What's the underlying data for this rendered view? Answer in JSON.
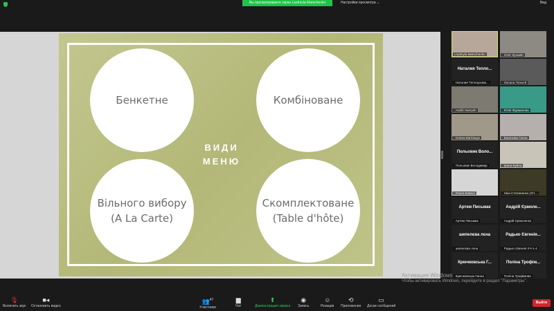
{
  "topbar": {
    "sharing_banner": "Вы просматриваете экран Liudmyla Mamchenko",
    "view_options": "Настройки просмотра ⌄",
    "view_button": "Вид"
  },
  "slide": {
    "title_line1": "ВИДИ",
    "title_line2": "МЕНЮ",
    "circles": [
      {
        "line1": "Бенкетне",
        "line2": ""
      },
      {
        "line1": "Комбіноване",
        "line2": ""
      },
      {
        "line1": "Вільного вибору",
        "line2": "(A La Carte)"
      },
      {
        "line1": "Скомплектоване",
        "line2": "(Table d'hôte)"
      }
    ]
  },
  "participants": [
    {
      "name": "Liudmyla Mamchenko",
      "big": "",
      "video": "#b7a79a",
      "active": true,
      "muted": false
    },
    {
      "name": "Олег Кузьмін",
      "big": "",
      "video": "#8d8a84",
      "muted": true
    },
    {
      "name": "Наталия Теплоухова...",
      "big": "Наталия Тепло...",
      "video": "",
      "muted": true
    },
    {
      "name": "Оксана Похоєй",
      "big": "",
      "video": "#5a5a5a",
      "muted": true
    },
    {
      "name": "Andrii Havrysh",
      "big": "",
      "video": "#7d7a72",
      "muted": true
    },
    {
      "name": "Юлія Фурманова",
      "big": "",
      "video": "#3a9a88",
      "muted": true
    },
    {
      "name": "Олена Матіяшук",
      "big": "",
      "video": "#a09888",
      "muted": true
    },
    {
      "name": "Березова Ганна",
      "big": "",
      "video": "#b5b0ad",
      "muted": true
    },
    {
      "name": "Польовик Володимир",
      "big": "Польовик Воло...",
      "video": "",
      "muted": true
    },
    {
      "name": "Ірина Буйна",
      "big": "",
      "video": "#c8c4b8",
      "muted": true
    },
    {
      "name": "Ольга Ковалі",
      "big": "",
      "video": "#d6d6d6",
      "muted": true
    },
    {
      "name": "Ніка Степаненко (ХЧ...",
      "big": "",
      "video": "#3d3a25",
      "muted": true
    },
    {
      "name": "Артем Письмак",
      "big": "Артем Письмак",
      "video": "",
      "muted": true
    },
    {
      "name": "Андрій Єрмоленко",
      "big": "Андрій Єрмоле...",
      "video": "",
      "muted": true
    },
    {
      "name": "шепелєва лєна",
      "big": "шепелєва лєна",
      "video": "",
      "muted": true
    },
    {
      "name": "Радько Євгенія ХЧ-1-4",
      "big": "Радько Євгенія...",
      "video": "",
      "muted": true
    },
    {
      "name": "Крючковська Ганна",
      "big": "Крючковська Г...",
      "video": "",
      "muted": true
    },
    {
      "name": "Поліна Трофімова",
      "big": "Поліна Трофім...",
      "video": "",
      "muted": true
    }
  ],
  "watermark": {
    "title": "Активация Windows",
    "subtitle": "Чтобы активировать Windows, перейдите в раздел \"Параметры\"."
  },
  "toolbar": {
    "unmute": "Включить звук",
    "video": "Остановить видео",
    "participants": "Участники",
    "participants_count": "47",
    "chat": "Чат",
    "share": "Демонстрация экрана",
    "record": "Запись",
    "reactions": "Реакции",
    "apps": "Приложения",
    "whiteboards": "Доски сообщений",
    "leave": "Выйти"
  }
}
